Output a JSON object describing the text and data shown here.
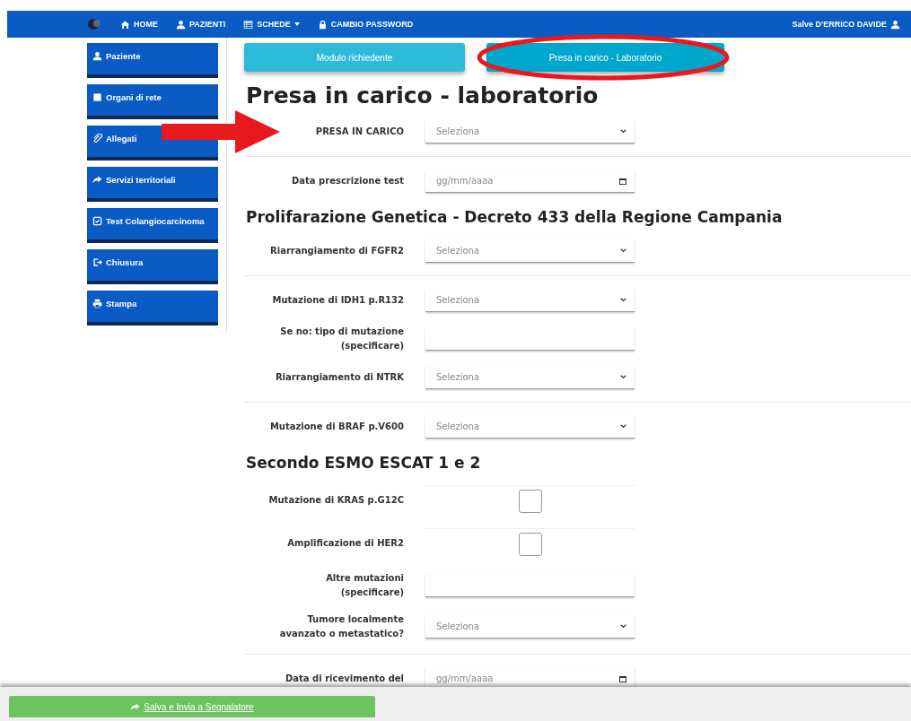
{
  "navbar": {
    "items": [
      {
        "label": "HOME",
        "dropdown": false
      },
      {
        "label": "PAZIENTI",
        "dropdown": false
      },
      {
        "label": "SCHEDE",
        "dropdown": true
      },
      {
        "label": "CAMBIO PASSWORD",
        "dropdown": false
      }
    ],
    "greeting": "Salve D'ERRICO DAVIDE"
  },
  "sidebar": {
    "items": [
      {
        "label": "Paziente"
      },
      {
        "label": "Organi di rete"
      },
      {
        "label": "Allegati"
      },
      {
        "label": "Servizi territoriali"
      },
      {
        "label": "Test Colangiocarcinoma"
      },
      {
        "label": "Chiusura"
      },
      {
        "label": "Stampa"
      }
    ]
  },
  "tabs": [
    {
      "label": "Modulo richiedente",
      "selected": false
    },
    {
      "label": "Presa in carico - Laboratorio",
      "selected": true
    }
  ],
  "title": "Presa in carico - laboratorio",
  "form": [
    {
      "kind": "select",
      "label": "PRESA IN CARICO",
      "placeholder": "Seleziona"
    },
    {
      "kind": "divider"
    },
    {
      "kind": "date",
      "label": "Data prescrizione test",
      "placeholder": "gg/mm/aaaa"
    },
    {
      "kind": "heading",
      "label": "Prolifarazione Genetica - Decreto 433 della Regione Campania"
    },
    {
      "kind": "select",
      "label": "Riarrangiamento di FGFR2",
      "placeholder": "Seleziona"
    },
    {
      "kind": "divider"
    },
    {
      "kind": "select",
      "label": "Mutazione di IDH1 p.R132",
      "placeholder": "Seleziona"
    },
    {
      "kind": "text",
      "label": "Se no: tipo di mutazione\n(specificare)"
    },
    {
      "kind": "select",
      "label": "Riarrangiamento di NTRK",
      "placeholder": "Seleziona"
    },
    {
      "kind": "divider"
    },
    {
      "kind": "select",
      "label": "Mutazione di BRAF p.V600",
      "placeholder": "Seleziona"
    },
    {
      "kind": "heading",
      "label": "Secondo ESMO ESCAT 1 e 2"
    },
    {
      "kind": "checkbox",
      "label": "Mutazione di KRAS p.G12C",
      "checked": false
    },
    {
      "kind": "checkbox",
      "label": "Amplificazione di HER2",
      "checked": false
    },
    {
      "kind": "text",
      "label": "Altre mutazioni\n(specificare)"
    },
    {
      "kind": "select",
      "label": "Tumore localmente\navanzato o metastatico?",
      "placeholder": "Seleziona"
    },
    {
      "kind": "divider"
    },
    {
      "kind": "date",
      "label": "Data di ricevimento del",
      "placeholder": "gg/mm/aaaa"
    }
  ],
  "footer": {
    "button": "Salva e Invia a Segnalatore"
  }
}
